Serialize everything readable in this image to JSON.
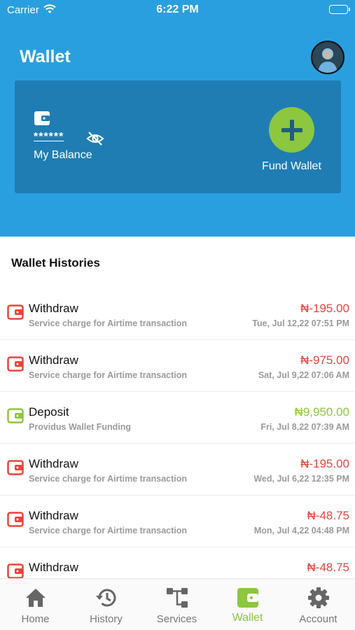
{
  "status_bar": {
    "carrier": "Carrier",
    "time": "6:22 PM"
  },
  "header": {
    "title": "Wallet",
    "avatar_icon": "user-avatar"
  },
  "balance_card": {
    "masked_balance": "******",
    "label": "My Balance",
    "fund_label": "Fund Wallet",
    "icons": [
      "wallet-icon",
      "eye-off-icon",
      "plus-icon"
    ]
  },
  "colors": {
    "primary": "#2a9fdf",
    "card": "#1f7db4",
    "accent": "#8dc63f",
    "withdraw": "#e8443a",
    "deposit": "#8dc63f"
  },
  "histories": {
    "title": "Wallet Histories",
    "items": [
      {
        "type": "Withdraw",
        "desc": "Service charge for Airtime transaction",
        "amount": "₦-195.00",
        "date": "Tue, Jul 12,22 07:51 PM",
        "kind": "withdraw"
      },
      {
        "type": "Withdraw",
        "desc": "Service charge for Airtime transaction",
        "amount": "₦-975.00",
        "date": "Sat, Jul 9,22 07:06 AM",
        "kind": "withdraw"
      },
      {
        "type": "Deposit",
        "desc": "Providus Wallet Funding",
        "amount": "₦9,950.00",
        "date": "Fri, Jul 8,22 07:39 AM",
        "kind": "deposit"
      },
      {
        "type": "Withdraw",
        "desc": "Service charge for Airtime transaction",
        "amount": "₦-195.00",
        "date": "Wed, Jul 6,22 12:35 PM",
        "kind": "withdraw"
      },
      {
        "type": "Withdraw",
        "desc": "Service charge for Airtime transaction",
        "amount": "₦-48.75",
        "date": "Mon, Jul 4,22 04:48 PM",
        "kind": "withdraw"
      },
      {
        "type": "Withdraw",
        "desc": "",
        "amount": "₦-48.75",
        "date": "",
        "kind": "withdraw"
      }
    ]
  },
  "tabs": [
    {
      "label": "Home",
      "icon": "home-icon"
    },
    {
      "label": "History",
      "icon": "history-icon"
    },
    {
      "label": "Services",
      "icon": "services-icon"
    },
    {
      "label": "Wallet",
      "icon": "wallet-icon",
      "active": true
    },
    {
      "label": "Account",
      "icon": "gear-icon"
    }
  ]
}
